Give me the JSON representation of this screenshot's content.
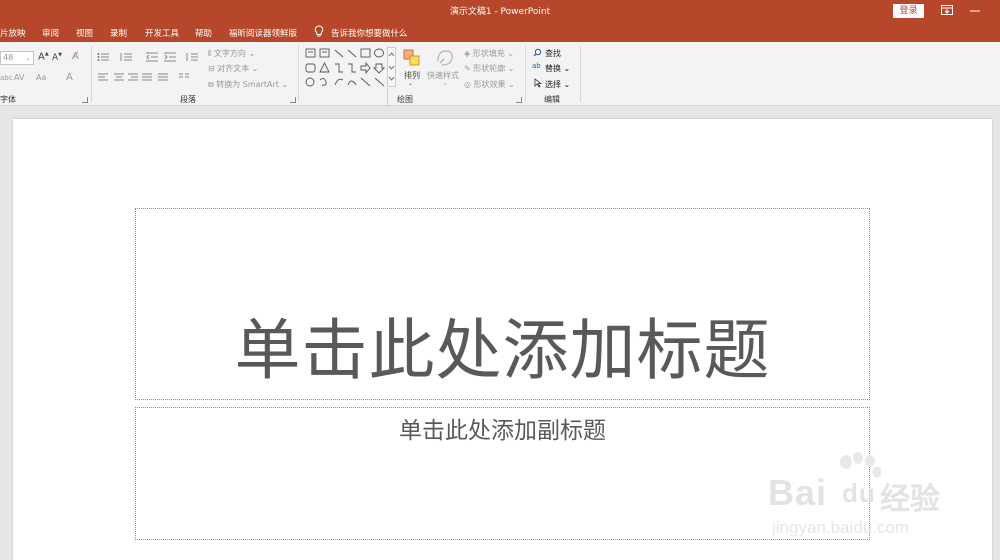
{
  "titlebar": {
    "doc_title": "演示文稿1  -  PowerPoint",
    "login_label": "登录"
  },
  "tabs": [
    "片放映",
    "审阅",
    "视图",
    "录制",
    "开发工具",
    "帮助",
    "福昕阅读器领鲜版"
  ],
  "tell_me": "告诉我你想要做什么",
  "ribbon": {
    "font": {
      "label": "字体",
      "size_value": "48",
      "grow": "A",
      "shrink": "A",
      "abc": "abc",
      "spacing": "AV",
      "case": "Aa",
      "color": "A"
    },
    "paragraph": {
      "label": "段落",
      "text_direction": "文字方向",
      "align_text": "对齐文本",
      "convert_smartart": "转换为 SmartArt"
    },
    "drawing": {
      "label": "绘图",
      "arrange": "排列",
      "quick_styles": "快速样式",
      "shape_fill": "形状填充",
      "shape_outline": "形状轮廓",
      "shape_effects": "形状效果"
    },
    "editing": {
      "label": "编辑",
      "find": "查找",
      "replace": "替换",
      "select": "选择"
    }
  },
  "slide": {
    "title_placeholder": "单击此处添加标题",
    "subtitle_placeholder": "单击此处添加副标题"
  },
  "watermark": {
    "brand": "Bai",
    "brand2": "经验",
    "brand_du": "du",
    "url": "jingyan.baidu.com"
  }
}
